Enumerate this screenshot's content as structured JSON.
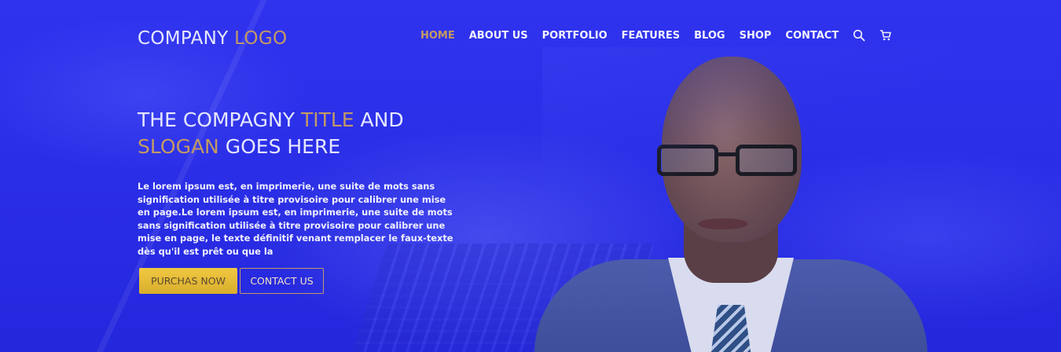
{
  "header": {
    "logo_main": "COMPANY",
    "logo_accent": "LOGO",
    "nav": [
      {
        "label": "HOME",
        "active": true
      },
      {
        "label": "ABOUT US",
        "active": false
      },
      {
        "label": "PORTFOLIO",
        "active": false
      },
      {
        "label": "FEATURES",
        "active": false
      },
      {
        "label": "BLOG",
        "active": false
      },
      {
        "label": "SHOP",
        "active": false
      },
      {
        "label": "CONTACT",
        "active": false
      }
    ],
    "icons": [
      "search-icon",
      "cart-icon"
    ]
  },
  "hero": {
    "title_part1": "THE COMPAGNY",
    "title_accent1": "TITLE",
    "title_part2": "AND",
    "title_accent2": "SLOGAN",
    "title_part3": "GOES HERE",
    "description": "Le lorem ipsum est, en imprimerie, une suite de mots sans signification utilisée à titre provisoire pour calibrer une mise en page.Le lorem ipsum est, en imprimerie, une suite de mots sans signification utilisée à titre provisoire pour calibrer une mise en page, le texte définitif venant remplacer le faux-texte dès qu'il est prêt ou que la",
    "purchase_label": "PURCHAS NOW",
    "contact_label": "CONTACT US"
  },
  "colors": {
    "background": "#2a2ee6",
    "accent": "#c39a64",
    "button_yellow": "#f1c842",
    "text": "#e6e7ff"
  }
}
